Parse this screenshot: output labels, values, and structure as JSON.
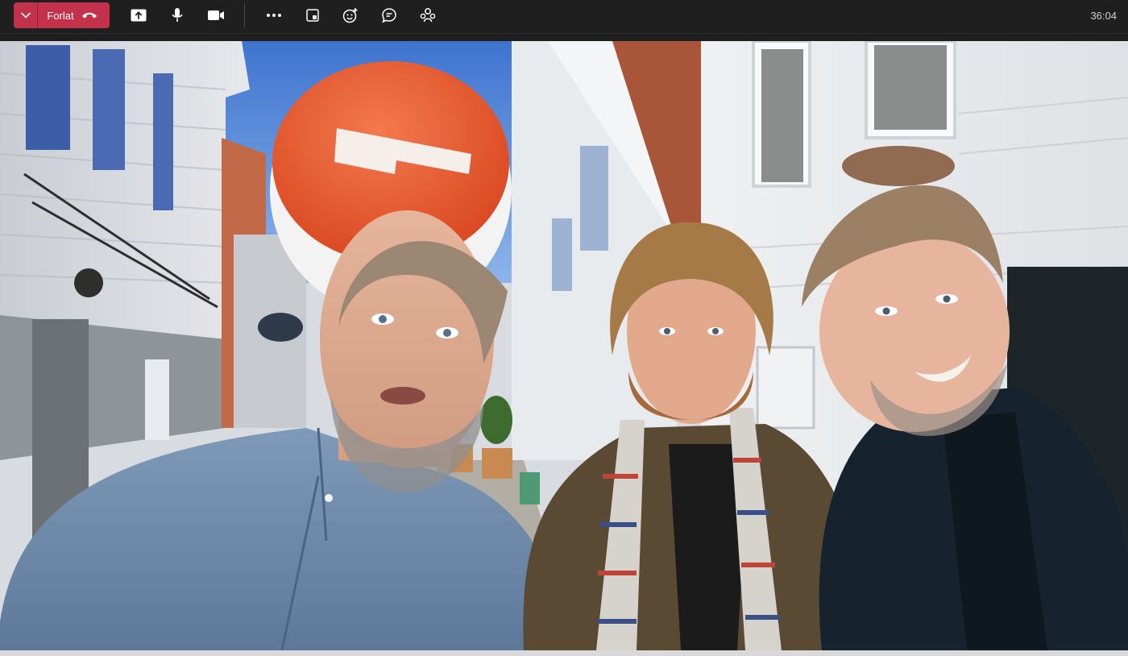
{
  "toolbar": {
    "leave_label": "Forlat",
    "buttons": [
      {
        "name": "share-icon"
      },
      {
        "name": "microphone-icon"
      },
      {
        "name": "camera-icon"
      },
      {
        "name": "more-options-icon"
      },
      {
        "name": "meeting-room-icon"
      },
      {
        "name": "reactions-icon"
      },
      {
        "name": "chat-icon"
      },
      {
        "name": "participants-icon"
      }
    ],
    "timer": "36:04"
  },
  "colors": {
    "toolbar_bg": "#1f1f1f",
    "leave_red": "#c4314b",
    "icon_white": "#ffffff",
    "sky": "#4b82d6",
    "roof": "#b25a3a",
    "logo_orange": "#e65a2f"
  },
  "video": {
    "background": "street-with-white-wooden-houses",
    "participants": [
      {
        "name": "participant-left",
        "shirt": "light-blue-denim-shirt"
      },
      {
        "name": "participant-middle",
        "shirt": "brown-jacket-with-plaid-scarf"
      },
      {
        "name": "participant-right",
        "shirt": "navy-blazer"
      }
    ]
  }
}
